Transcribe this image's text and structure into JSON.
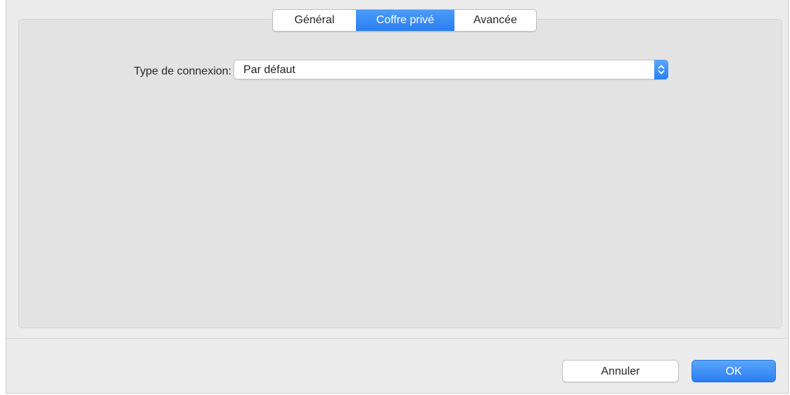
{
  "tabs": [
    {
      "label": "Général",
      "active": false
    },
    {
      "label": "Coffre privé",
      "active": true
    },
    {
      "label": "Avancée",
      "active": false
    }
  ],
  "connection": {
    "label": "Type de connexion:",
    "selected_value": "Par défaut",
    "arrow_icon": "chevron-up-down-icon"
  },
  "footer": {
    "cancel_label": "Annuler",
    "ok_label": "OK"
  },
  "colors": {
    "accent": "#2a7ef2",
    "window_bg": "#ececec",
    "panel_bg": "#e3e3e3"
  }
}
